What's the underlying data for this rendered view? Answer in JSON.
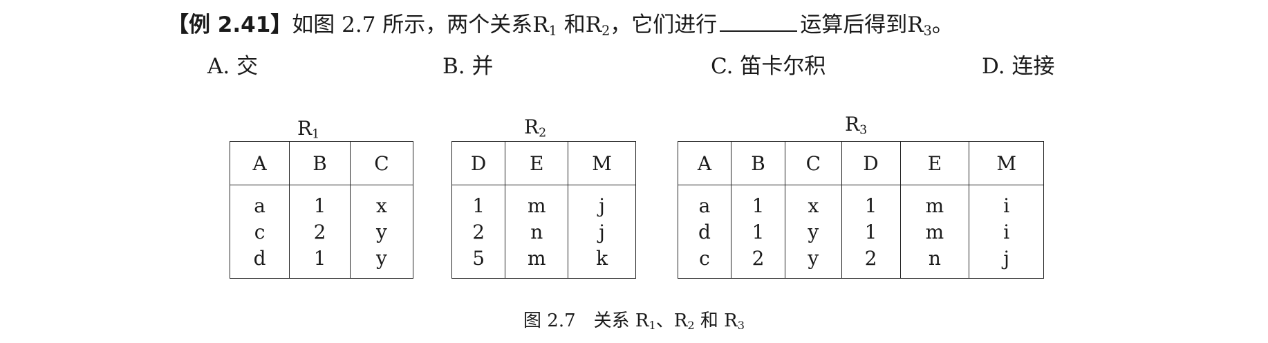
{
  "question": {
    "tag": "【例 2.41】",
    "text_before": "如图 2.7 所示，两个关系R",
    "sub1": "1",
    "text_mid": " 和R",
    "sub2": "2",
    "text_after": "，它们进行",
    "text_end": "运算后得到R",
    "sub3": "3",
    "period": "。"
  },
  "options": [
    {
      "label": "A. 交"
    },
    {
      "label": "B. 并"
    },
    {
      "label": "C. 笛卡尔积"
    },
    {
      "label": "D. 连接"
    }
  ],
  "tables": [
    {
      "name": "R",
      "sub": "1",
      "headers": [
        "A",
        "B",
        "C"
      ],
      "rows": [
        [
          "a",
          "1",
          "x"
        ],
        [
          "c",
          "2",
          "y"
        ],
        [
          "d",
          "1",
          "y"
        ]
      ]
    },
    {
      "name": "R",
      "sub": "2",
      "headers": [
        "D",
        "E",
        "M"
      ],
      "rows": [
        [
          "1",
          "m",
          "j"
        ],
        [
          "2",
          "n",
          "j"
        ],
        [
          "5",
          "m",
          "k"
        ]
      ]
    },
    {
      "name": "R",
      "sub": "3",
      "headers": [
        "A",
        "B",
        "C",
        "D",
        "E",
        "M"
      ],
      "rows": [
        [
          "a",
          "1",
          "x",
          "1",
          "m",
          "i"
        ],
        [
          "d",
          "1",
          "y",
          "1",
          "m",
          "i"
        ],
        [
          "c",
          "2",
          "y",
          "2",
          "n",
          "j"
        ]
      ]
    }
  ],
  "caption": {
    "prefix": "图 2.7　关系 R",
    "s1": "1",
    "sep": "、R",
    "s2": "2",
    "and": " 和 R",
    "s3": "3"
  }
}
